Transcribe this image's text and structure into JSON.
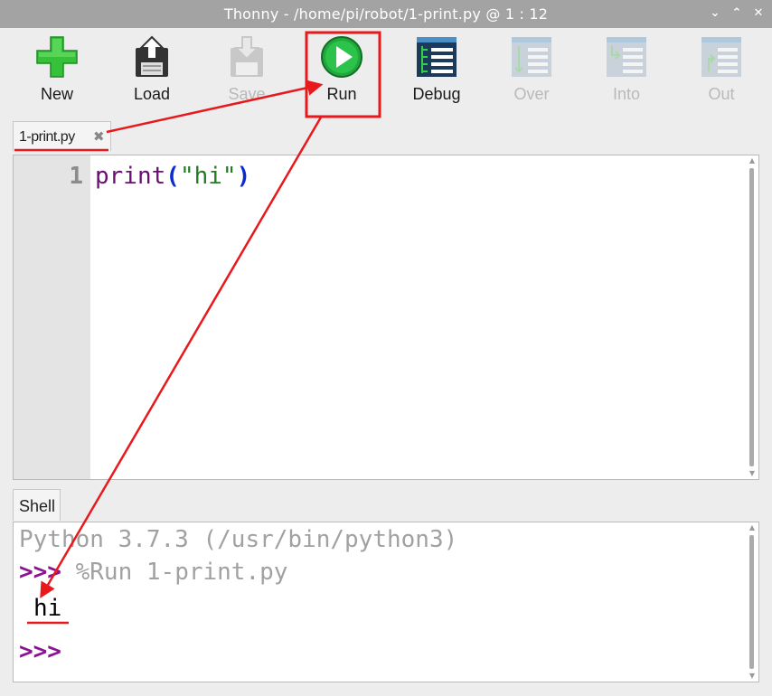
{
  "window": {
    "title": "Thonny  -  /home/pi/robot/1-print.py  @  1 : 12",
    "controls": {
      "minimize": "⌄",
      "maximize": "⌃",
      "close": "✕"
    }
  },
  "toolbar": {
    "new_label": "New",
    "load_label": "Load",
    "save_label": "Save",
    "run_label": "Run",
    "debug_label": "Debug",
    "over_label": "Over",
    "into_label": "Into",
    "out_label": "Out"
  },
  "editor": {
    "tab_label": "1-print.py",
    "tab_close": "✖",
    "line_number": "1",
    "code": {
      "func": "print",
      "open": "(",
      "string": "\"hi\"",
      "close": ")"
    }
  },
  "shell": {
    "tab_label": "Shell",
    "banner": "Python 3.7.3 (/usr/bin/python3)",
    "prompt": ">>>",
    "run_command": " %Run 1-print.py",
    "output": "hi"
  },
  "colors": {
    "annotation": "#e8191c",
    "run_green": "#20a83c",
    "new_green": "#35c23a"
  },
  "icons": {
    "new": "plus-icon",
    "load": "floppy-load-icon",
    "save": "floppy-save-icon",
    "run": "play-icon",
    "debug": "debug-icon",
    "over": "step-over-icon",
    "into": "step-into-icon",
    "out": "step-out-icon"
  }
}
